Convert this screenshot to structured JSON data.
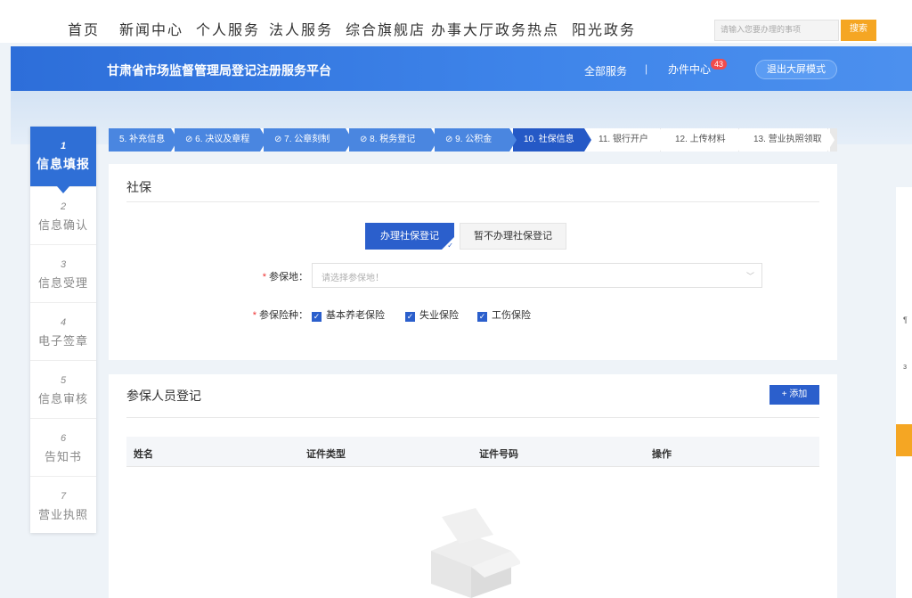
{
  "top_nav": {
    "items": [
      "首页",
      "新闻中心",
      "个人服务",
      "法人服务",
      "综合旗舰店",
      "办事大厅",
      "政务热点",
      "阳光政务"
    ],
    "search_placeholder": "请输入您要办理的事项",
    "search_button": "搜索"
  },
  "header": {
    "title": "甘肃省市场监督管理局登记注册服务平台",
    "all_services": "全部服务",
    "separator": "|",
    "office_center": "办件中心",
    "office_badge": "43",
    "exit_button": "退出大屏模式"
  },
  "sidebar": {
    "steps": [
      {
        "num": "1",
        "label": "信息填报"
      },
      {
        "num": "2",
        "label": "信息确认"
      },
      {
        "num": "3",
        "label": "信息受理"
      },
      {
        "num": "4",
        "label": "电子签章"
      },
      {
        "num": "5",
        "label": "信息审核"
      },
      {
        "num": "6",
        "label": "告知书"
      },
      {
        "num": "7",
        "label": "营业执照"
      }
    ]
  },
  "tabs": {
    "left_arrow": "◂",
    "items": [
      {
        "label": "5. 补充信息"
      },
      {
        "label": "⊘ 6. 决议及章程"
      },
      {
        "label": "⊘ 7. 公章刻制"
      },
      {
        "label": "⊘ 8. 税务登记"
      },
      {
        "label": "⊘ 9. 公积金"
      },
      {
        "label": "10. 社保信息"
      },
      {
        "label": "11. 银行开户"
      },
      {
        "label": "12. 上传材料"
      },
      {
        "label": "13. 营业执照领取"
      }
    ]
  },
  "social": {
    "title": "社保",
    "btn_yes": "办理社保登记",
    "btn_no": "暂不办理社保登记",
    "place_label": "参保地：",
    "place_placeholder": "请选择参保地！",
    "type_label": "参保险种：",
    "types": [
      "基本养老保险",
      "失业保险",
      "工伤保险"
    ]
  },
  "register": {
    "title": "参保人员登记",
    "add_button": "+ 添加",
    "columns": [
      "姓名",
      "证件类型",
      "证件号码",
      "操作"
    ]
  },
  "right_panel": {
    "t1": "¶",
    "t2": "з"
  },
  "colors": {
    "primary": "#2b5fcc",
    "header": "#3a7fe6",
    "accent": "#f5a623",
    "badge": "#f24b4b"
  }
}
